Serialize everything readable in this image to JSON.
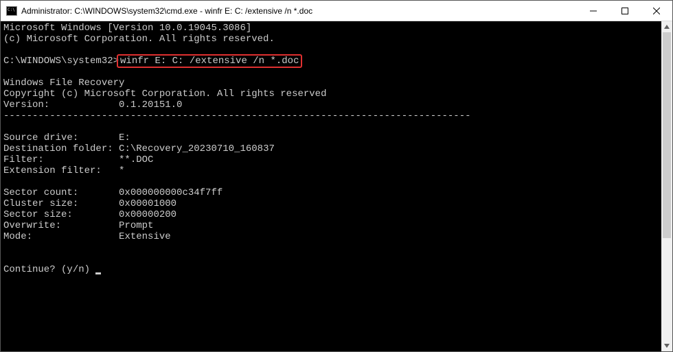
{
  "titlebar": {
    "title": "Administrator: C:\\WINDOWS\\system32\\cmd.exe - winfr  E: C: /extensive /n *.doc"
  },
  "terminal": {
    "line1": "Microsoft Windows [Version 10.0.19045.3086]",
    "line2": "(c) Microsoft Corporation. All rights reserved.",
    "prompt_prefix": "C:\\WINDOWS\\system32>",
    "command": "winfr E: C: /extensive /n *.doc",
    "app_name": "Windows File Recovery",
    "copyright": "Copyright (c) Microsoft Corporation. All rights reserved",
    "version_label": "Version:",
    "version_value": "0.1.20151.0",
    "separator": "---------------------------------------------------------------------------------",
    "src_label": "Source drive:",
    "src_value": "E:",
    "dest_label": "Destination folder:",
    "dest_value": "C:\\Recovery_20230710_160837",
    "filter_label": "Filter:",
    "filter_value": "**.DOC",
    "ext_label": "Extension filter:",
    "ext_value": "*",
    "sector_count_label": "Sector count:",
    "sector_count_value": "0x000000000c34f7ff",
    "cluster_label": "Cluster size:",
    "cluster_value": "0x00001000",
    "sector_size_label": "Sector size:",
    "sector_size_value": "0x00000200",
    "overwrite_label": "Overwrite:",
    "overwrite_value": "Prompt",
    "mode_label": "Mode:",
    "mode_value": "Extensive",
    "continue_prompt": "Continue? (y/n) "
  }
}
